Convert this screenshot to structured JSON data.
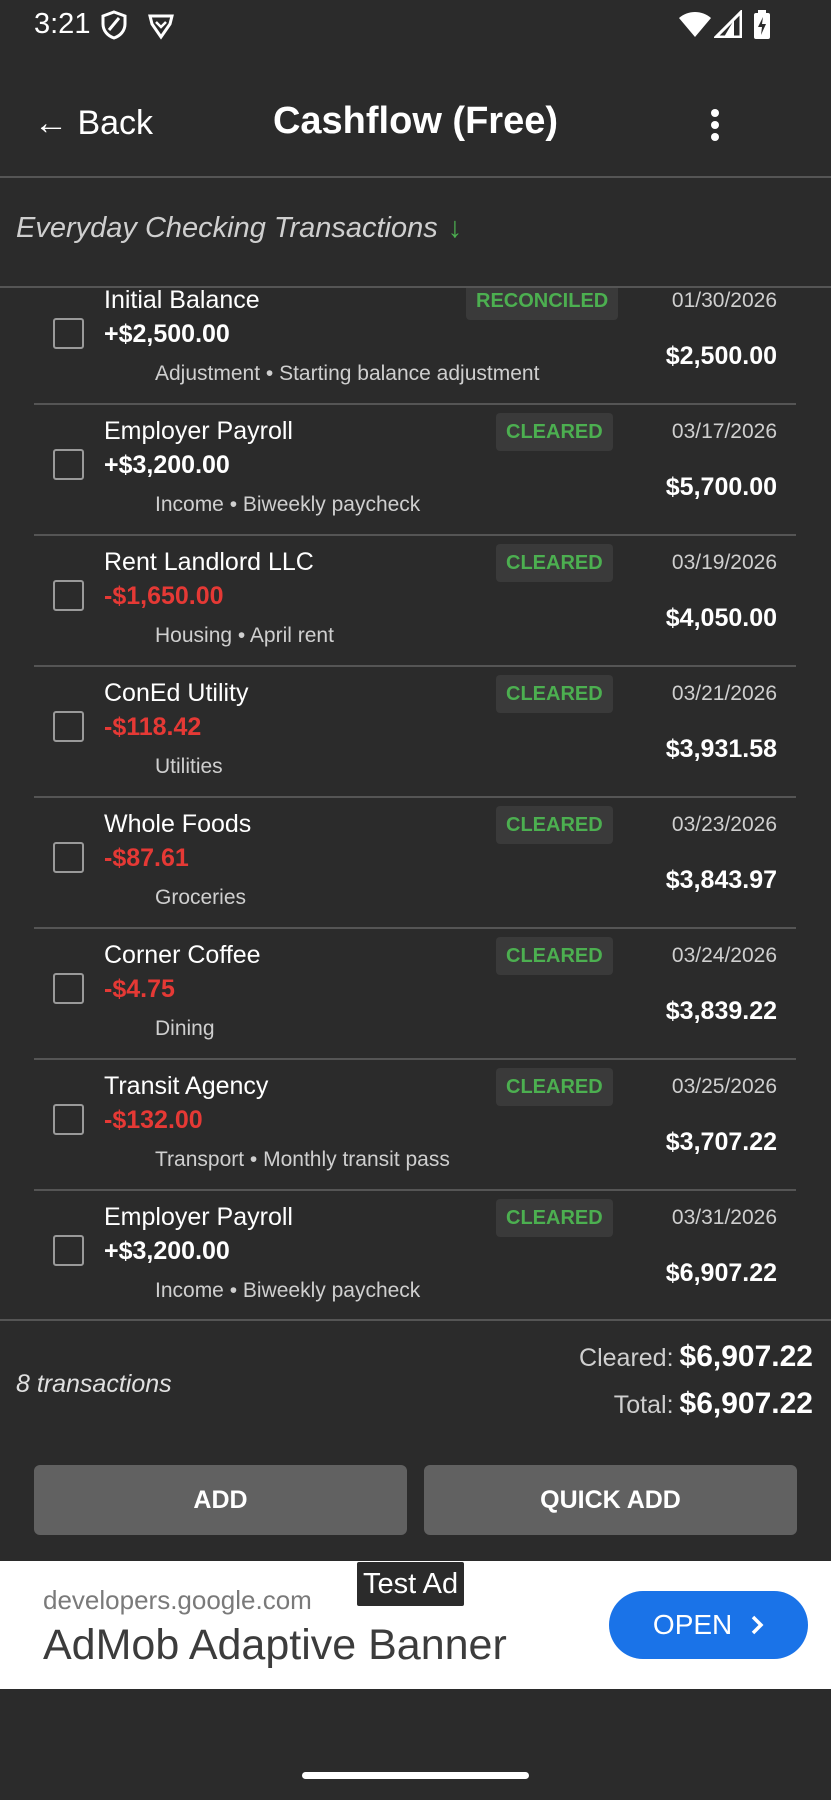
{
  "status_bar": {
    "time": "3:21"
  },
  "app_bar": {
    "back_label": "← Back",
    "title": "Cashflow (Free)"
  },
  "account": {
    "name": "Everyday Checking Transactions",
    "arrow": "↓"
  },
  "transactions": [
    {
      "payee": "Initial Balance",
      "amount": "+$2,500.00",
      "sign": "pos",
      "status": "RECONCILED",
      "date": "01/30/2026",
      "meta": "Adjustment • Starting balance adjustment",
      "balance": "$2,500.00"
    },
    {
      "payee": "Employer Payroll",
      "amount": "+$3,200.00",
      "sign": "pos",
      "status": "CLEARED",
      "date": "03/17/2026",
      "meta": "Income • Biweekly paycheck",
      "balance": "$5,700.00"
    },
    {
      "payee": "Rent Landlord LLC",
      "amount": "-$1,650.00",
      "sign": "neg",
      "status": "CLEARED",
      "date": "03/19/2026",
      "meta": "Housing • April rent",
      "balance": "$4,050.00"
    },
    {
      "payee": "ConEd Utility",
      "amount": "-$118.42",
      "sign": "neg",
      "status": "CLEARED",
      "date": "03/21/2026",
      "meta": "Utilities",
      "balance": "$3,931.58"
    },
    {
      "payee": "Whole Foods",
      "amount": "-$87.61",
      "sign": "neg",
      "status": "CLEARED",
      "date": "03/23/2026",
      "meta": "Groceries",
      "balance": "$3,843.97"
    },
    {
      "payee": "Corner Coffee",
      "amount": "-$4.75",
      "sign": "neg",
      "status": "CLEARED",
      "date": "03/24/2026",
      "meta": "Dining",
      "balance": "$3,839.22"
    },
    {
      "payee": "Transit Agency",
      "amount": "-$132.00",
      "sign": "neg",
      "status": "CLEARED",
      "date": "03/25/2026",
      "meta": "Transport • Monthly transit pass",
      "balance": "$3,707.22"
    },
    {
      "payee": "Employer Payroll",
      "amount": "+$3,200.00",
      "sign": "pos",
      "status": "CLEARED",
      "date": "03/31/2026",
      "meta": "Income • Biweekly paycheck",
      "balance": "$6,907.22"
    }
  ],
  "summary": {
    "count": "8 transactions",
    "cleared_label": "Cleared:",
    "cleared_value": "$6,907.22",
    "total_label": "Total:",
    "total_value": "$6,907.22"
  },
  "actions": {
    "add": "ADD",
    "quick_add": "QUICK ADD"
  },
  "ad": {
    "badge": "Test Ad",
    "domain": "developers.google.com",
    "title": "AdMob Adaptive Banner",
    "open": "OPEN"
  },
  "colors": {
    "background": "#2b2b2b",
    "positive_status": "#4caf50",
    "negative_amount": "#e53935",
    "button": "#616161",
    "ad_button": "#1a73e8"
  }
}
